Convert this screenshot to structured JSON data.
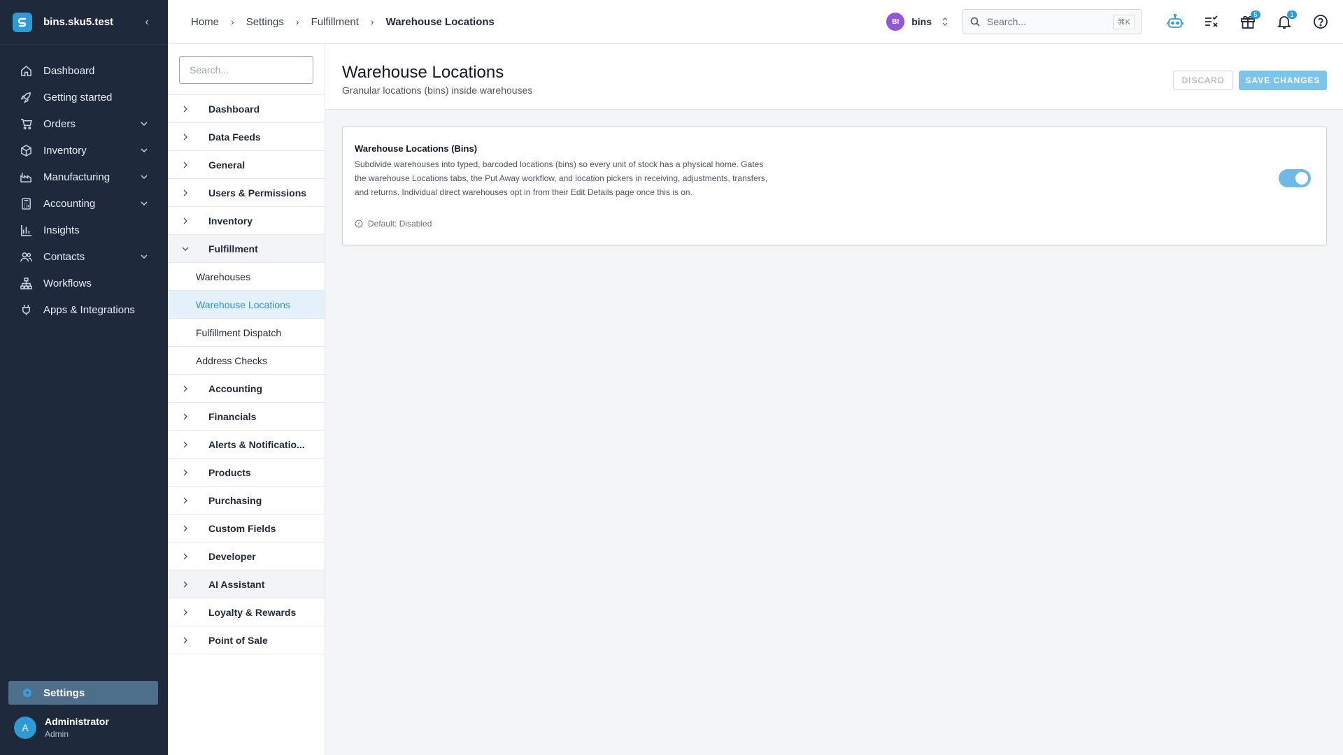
{
  "app": {
    "tenant": "bins.sku5.test",
    "colors": {
      "nav_bg": "#1e2a3b",
      "accent": "#2f9bd6",
      "save_button": "#7cc4ea",
      "org_badge": "#9257d6"
    }
  },
  "nav": {
    "items": [
      {
        "label": "Dashboard",
        "icon": "home-icon",
        "expandable": false
      },
      {
        "label": "Getting started",
        "icon": "rocket-icon",
        "expandable": false
      },
      {
        "label": "Orders",
        "icon": "cart-icon",
        "expandable": true
      },
      {
        "label": "Inventory",
        "icon": "box-icon",
        "expandable": true
      },
      {
        "label": "Manufacturing",
        "icon": "factory-icon",
        "expandable": true
      },
      {
        "label": "Accounting",
        "icon": "calculator-icon",
        "expandable": true
      },
      {
        "label": "Insights",
        "icon": "bar-chart-icon",
        "expandable": false
      },
      {
        "label": "Contacts",
        "icon": "people-icon",
        "expandable": true
      },
      {
        "label": "Workflows",
        "icon": "workflow-icon",
        "expandable": false
      },
      {
        "label": "Apps & Integrations",
        "icon": "plug-icon",
        "expandable": false
      }
    ],
    "settings_label": "Settings",
    "user": {
      "initial": "A",
      "name": "Administrator",
      "role": "Admin"
    }
  },
  "topbar": {
    "breadcrumbs": [
      "Home",
      "Settings",
      "Fulfillment",
      "Warehouse Locations"
    ],
    "org": {
      "initials": "BI",
      "name": "bins"
    },
    "search": {
      "placeholder": "Search...",
      "shortcut": "⌘K"
    },
    "badges": {
      "gifts": "5",
      "notifications": "1"
    }
  },
  "settings_sidebar": {
    "search_placeholder": "Search...",
    "items": [
      {
        "label": "Dashboard"
      },
      {
        "label": "Data Feeds"
      },
      {
        "label": "General"
      },
      {
        "label": "Users & Permissions"
      },
      {
        "label": "Inventory"
      },
      {
        "label": "Fulfillment",
        "expanded": true,
        "children": [
          "Warehouses",
          "Warehouse Locations",
          "Fulfillment Dispatch",
          "Address Checks"
        ],
        "active_child": "Warehouse Locations"
      },
      {
        "label": "Accounting"
      },
      {
        "label": "Financials"
      },
      {
        "label": "Alerts & Notificatio..."
      },
      {
        "label": "Products"
      },
      {
        "label": "Purchasing"
      },
      {
        "label": "Custom Fields"
      },
      {
        "label": "Developer"
      },
      {
        "label": "AI Assistant"
      },
      {
        "label": "Loyalty & Rewards"
      },
      {
        "label": "Point of Sale"
      }
    ]
  },
  "page": {
    "title": "Warehouse Locations",
    "subtitle": "Granular locations (bins) inside warehouses",
    "discard_label": "DISCARD",
    "save_label": "SAVE CHANGES",
    "setting": {
      "title": "Warehouse Locations (Bins)",
      "description": "Subdivide warehouses into typed, barcoded locations (bins) so every unit of stock has a physical home. Gates the warehouse Locations tabs, the Put Away workflow, and location pickers in receiving, adjustments, transfers, and returns. Individual direct warehouses opt in from their Edit Details page once this is on.",
      "default_text": "Default: Disabled",
      "enabled": true
    }
  }
}
